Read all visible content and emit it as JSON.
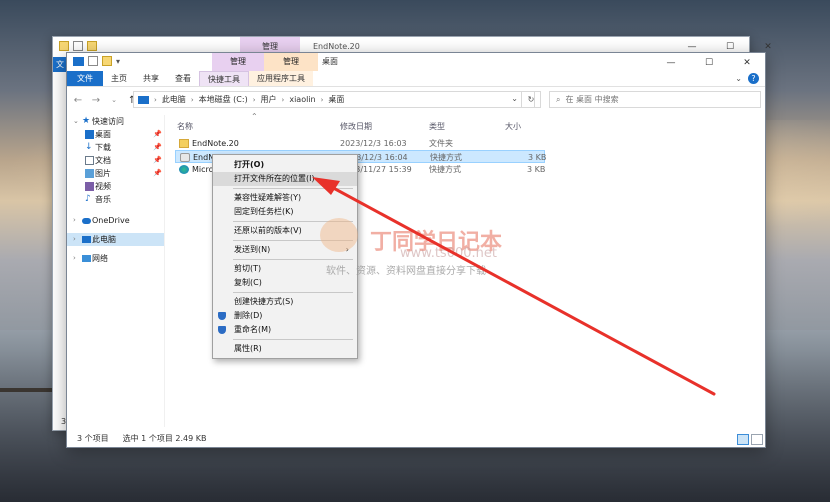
{
  "back_window": {
    "manage_tab": "管理",
    "title": "EndNote.20",
    "file_tab": "文",
    "status_count": "3"
  },
  "window": {
    "manage_tab_1": "管理",
    "manage_tab_2": "管理",
    "title": "桌面",
    "controls": [
      "—",
      "☐",
      "✕"
    ],
    "ribbon_tabs": [
      "文件",
      "主页",
      "共享",
      "查看",
      "快捷工具",
      "应用程序工具"
    ],
    "address": {
      "crumbs": [
        "此电脑",
        "本地磁盘 (C:)",
        "用户",
        "xiaolin",
        "桌面"
      ]
    },
    "search_placeholder": "在 桌面 中搜索",
    "sidebar": {
      "quick_access": "快速访问",
      "items": [
        "桌面",
        "下载",
        "文档",
        "图片",
        "视频",
        "音乐"
      ],
      "onedrive": "OneDrive",
      "this_pc": "此电脑",
      "network": "网络"
    },
    "columns": {
      "name": "名称",
      "modified": "修改日期",
      "type": "类型",
      "size": "大小"
    },
    "files": [
      {
        "name": "EndNote.20",
        "modified": "2023/12/3 16:03",
        "type": "文件夹",
        "size": ""
      },
      {
        "name": "EndNote",
        "modified": "2023/12/3 16:04",
        "type": "快捷方式",
        "size": "3 KB"
      },
      {
        "name": "Micro",
        "modified": "2023/11/27 15:39",
        "type": "快捷方式",
        "size": "3 KB"
      }
    ],
    "status": {
      "count": "3 个项目",
      "selected": "选中 1 个项目  2.49 KB"
    }
  },
  "context_menu": {
    "items": [
      "打开(O)",
      "打开文件所在的位置(I)",
      "兼容性疑难解答(Y)",
      "固定到任务栏(K)",
      "还原以前的版本(V)",
      "发送到(N)",
      "剪切(T)",
      "复制(C)",
      "创建快捷方式(S)",
      "删除(D)",
      "重命名(M)",
      "属性(R)"
    ]
  },
  "watermark": {
    "title": "丁同学日记本",
    "url": "www.ts000.net",
    "subtitle": "软件、资源、资料网盘直接分享下载"
  },
  "colors": {
    "accent": "#1a6fc9",
    "selection": "#cce8ff",
    "arrow": "#e8312a"
  }
}
